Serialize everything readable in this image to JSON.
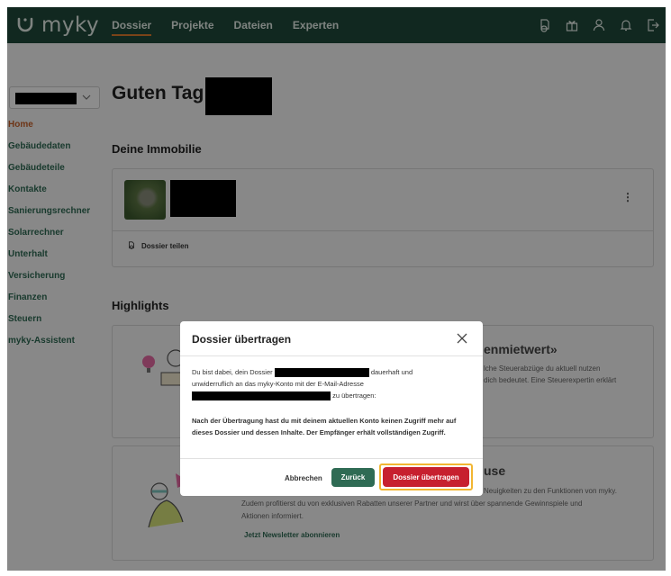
{
  "nav": {
    "logo_text": "myky",
    "links": [
      "Dossier",
      "Projekte",
      "Dateien",
      "Experten"
    ],
    "icons": [
      "document-icon",
      "gift-icon",
      "user-icon",
      "bell-icon",
      "logout-icon"
    ]
  },
  "sidebar": {
    "items": [
      "Home",
      "Gebäudedaten",
      "Gebäudeteile",
      "Kontakte",
      "Sanierungsrechner",
      "Solarrechner",
      "Unterhalt",
      "Versicherung",
      "Finanzen",
      "Steuern",
      "myky-Assistent"
    ]
  },
  "main": {
    "greeting": "Guten Tag",
    "property_heading": "Deine Immobilie",
    "share_label": "Dossier teilen",
    "highlights_heading": "Highlights",
    "highlight1": {
      "title": "enmietwert»",
      "text": "lche Steuerabzüge du aktuell nutzen\ndich bedeutet. Eine Steuerexpertin erklärt"
    },
    "highlight2": {
      "title": "use",
      "text_line1": "Neuigkeiten zu den Funktionen von myky.",
      "text_line2": "Zudem profitierst du von exklusiven Rabatten unserer Partner und wirst über spannende Gewinnspiele und",
      "text_line3": "Aktionen informiert.",
      "link": "Jetzt Newsletter abonnieren"
    }
  },
  "modal": {
    "title": "Dossier übertragen",
    "body_part1": "Du bist dabei, dein Dossier",
    "body_part2": "dauerhaft und",
    "body_part3": "unwiderruflich an das myky-Konto mit der E-Mail-Adresse",
    "body_part4": "zu übertragen:",
    "warning": "Nach der Übertragung hast du mit deinem aktuellen Konto keinen Zugriff mehr auf dieses Dossier und dessen Inhalte. Der Empfänger erhält vollständigen Zugriff.",
    "cancel_label": "Abbrechen",
    "back_label": "Zurück",
    "confirm_label": "Dossier übertragen"
  },
  "colors": {
    "nav_bg": "#1f4a3b",
    "accent": "#e07b2c",
    "primary_green": "#2f6b54",
    "danger": "#c7202f",
    "focus_ring": "#f2b632"
  }
}
